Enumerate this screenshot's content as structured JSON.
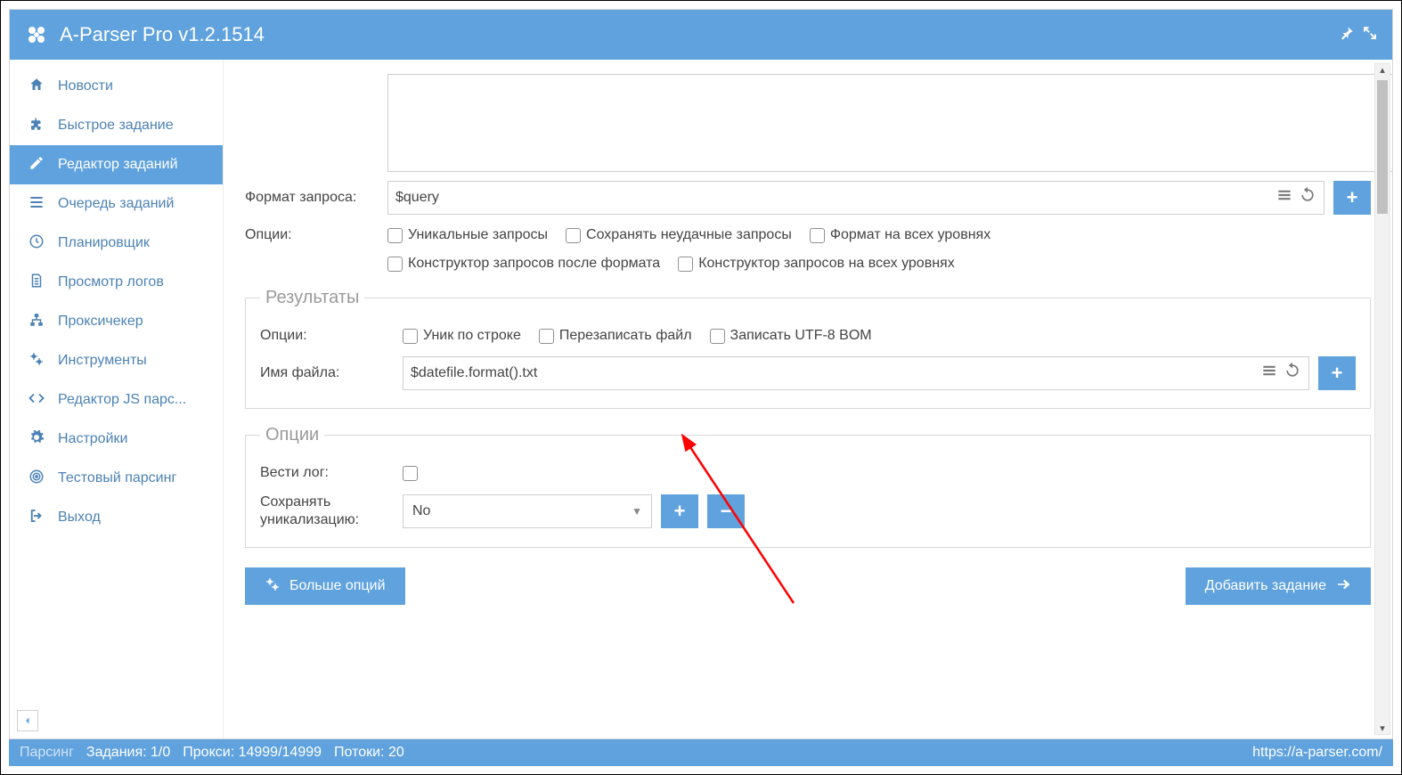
{
  "header": {
    "title": "A-Parser Pro v1.2.1514"
  },
  "sidebar": {
    "items": [
      {
        "label": "Новости"
      },
      {
        "label": "Быстрое задание"
      },
      {
        "label": "Редактор заданий"
      },
      {
        "label": "Очередь заданий"
      },
      {
        "label": "Планировщик"
      },
      {
        "label": "Просмотр логов"
      },
      {
        "label": "Проксичекер"
      },
      {
        "label": "Инструменты"
      },
      {
        "label": "Редактор JS парс..."
      },
      {
        "label": "Настройки"
      },
      {
        "label": "Тестовый парсинг"
      },
      {
        "label": "Выход"
      }
    ]
  },
  "form": {
    "format_query_label": "Формат запроса:",
    "format_query_value": "$query",
    "options_label": "Опции:",
    "opts1": {
      "unique_queries": "Уникальные запросы",
      "save_failed": "Сохранять неудачные запросы",
      "format_all_levels": "Формат на всех уровнях",
      "qb_after_format": "Конструктор запросов после формата",
      "qb_all_levels": "Конструктор запросов на всех уровнях"
    },
    "results_legend": "Результаты",
    "res_opts": {
      "unique_line": "Уник по строке",
      "overwrite": "Перезаписать файл",
      "utf8bom": "Записать UTF-8 BOM"
    },
    "filename_label": "Имя файла:",
    "filename_value": "$datefile.format().txt",
    "options_legend": "Опции",
    "log_label": "Вести лог:",
    "save_unique_label": "Сохранять уникализацию:",
    "save_unique_value": "No",
    "more_options": "Больше опций",
    "add_task": "Добавить задание"
  },
  "status": {
    "parsing": "Парсинг",
    "tasks": "Задания: 1/0",
    "proxies": "Прокси: 14999/14999",
    "threads": "Потоки: 20",
    "url": "https://a-parser.com/"
  }
}
